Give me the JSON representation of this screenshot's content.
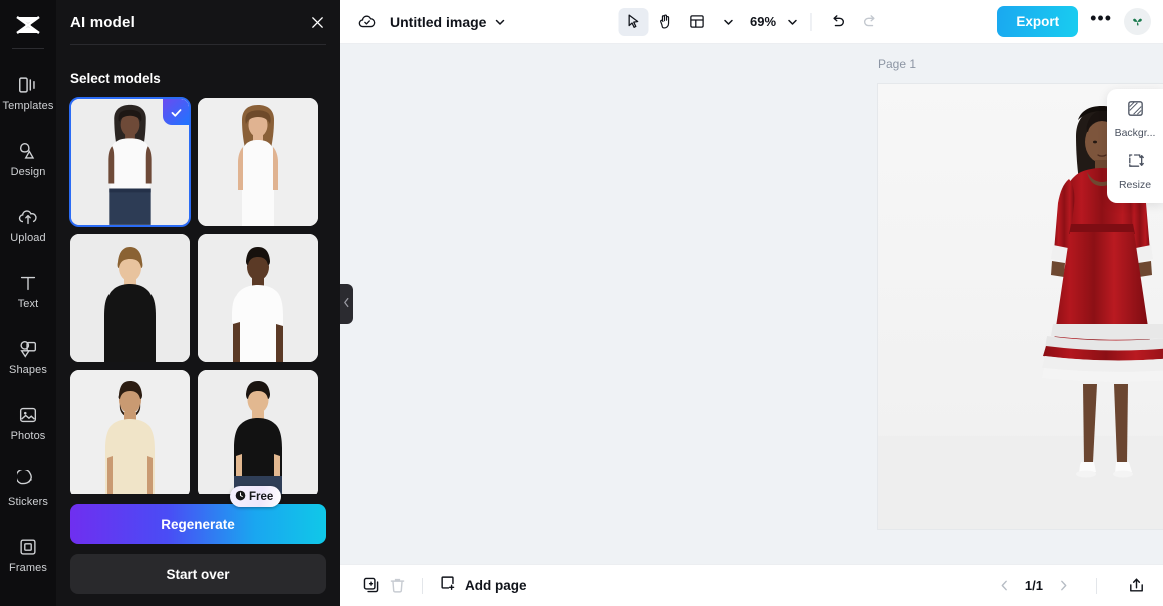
{
  "app": {
    "logo_icon": "capcut-logo-icon"
  },
  "sidebar": {
    "items": [
      {
        "label": "Templates",
        "icon": "templates-icon"
      },
      {
        "label": "Design",
        "icon": "design-icon"
      },
      {
        "label": "Upload",
        "icon": "upload-cloud-icon"
      },
      {
        "label": "Text",
        "icon": "text-icon"
      },
      {
        "label": "Shapes",
        "icon": "shapes-icon"
      },
      {
        "label": "Photos",
        "icon": "photos-icon"
      },
      {
        "label": "Stickers",
        "icon": "stickers-icon"
      },
      {
        "label": "Frames",
        "icon": "frames-icon"
      }
    ]
  },
  "panel": {
    "title": "AI model",
    "close_icon": "close-icon",
    "section_title": "Select models",
    "models": [
      {
        "id": 1,
        "alt": "Black female model in white sleeveless top and jeans",
        "selected": true
      },
      {
        "id": 2,
        "alt": "Brunette female model in white tank top",
        "selected": false
      },
      {
        "id": 3,
        "alt": "Male model in black long sleeve shirt",
        "selected": false
      },
      {
        "id": 4,
        "alt": "Male model in white t-shirt",
        "selected": false
      },
      {
        "id": 5,
        "alt": "Bearded male model in cream t-shirt",
        "selected": false
      },
      {
        "id": 6,
        "alt": "Male model in black t-shirt and jeans",
        "selected": false
      }
    ],
    "regenerate_label": "Regenerate",
    "free_badge_label": "Free",
    "free_badge_icon": "clock-icon",
    "start_over_label": "Start over",
    "collapse_icon": "chevron-left-icon"
  },
  "topbar": {
    "cloud_icon": "cloud-check-icon",
    "doc_title": "Untitled image",
    "title_caret_icon": "chevron-down-icon",
    "tools": [
      {
        "name": "select-tool",
        "icon": "cursor-icon",
        "active": true
      },
      {
        "name": "hand-tool",
        "icon": "hand-icon",
        "active": false
      },
      {
        "name": "layout-tool",
        "icon": "layout-icon",
        "active": false
      }
    ],
    "layout_caret_icon": "chevron-down-icon",
    "zoom_level": "69%",
    "zoom_caret_icon": "chevron-down-icon",
    "undo_icon": "undo-icon",
    "redo_icon": "redo-icon",
    "export_label": "Export",
    "more_label": "•••",
    "avatar_icon": "butterfly-avatar-icon"
  },
  "canvas": {
    "page_label": "Page 1",
    "duplicate_icon": "duplicate-page-icon",
    "artwork_alt": "Female model wearing a red velvet midi dress with white fur trim and white heels"
  },
  "floating_panel": {
    "items": [
      {
        "label": "Backgr...",
        "icon": "background-icon"
      },
      {
        "label": "Resize",
        "icon": "resize-icon"
      }
    ]
  },
  "bottombar": {
    "duplicate_icon": "duplicate-icon",
    "delete_icon": "trash-icon",
    "add_page_label": "Add page",
    "add_page_icon": "add-page-icon",
    "prev_icon": "chevron-left-icon",
    "page_indicator": "1/1",
    "next_icon": "chevron-right-icon",
    "export_tray_icon": "upload-tray-icon"
  },
  "colors": {
    "accent_blue": "#1aa8f0",
    "panel_bg": "#141416",
    "rail_bg": "#0d0d0f",
    "canvas_bg": "#eff2f5",
    "selection_blue": "#2b6cf5",
    "gradient_purple": "#6f2ff0",
    "dress_red": "#a8141b"
  }
}
